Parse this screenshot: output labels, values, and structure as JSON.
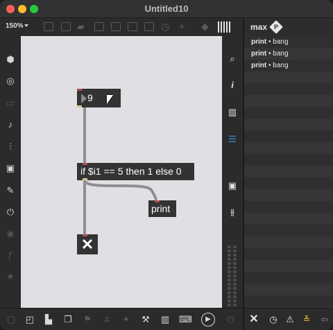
{
  "window": {
    "title": "Untitled10"
  },
  "toolbar": {
    "zoom": "150%"
  },
  "patch": {
    "number_box": {
      "value": "9"
    },
    "if_object": {
      "text": "if $i1 == 5 then 1 else 0"
    },
    "print_object": {
      "text": "print"
    },
    "toggle": {
      "glyph": "✕"
    }
  },
  "console": {
    "title": "max",
    "badge": "P",
    "messages": [
      {
        "object": "print",
        "separator": " • ",
        "message": "bang"
      },
      {
        "object": "print",
        "separator": " • ",
        "message": "bang"
      },
      {
        "object": "print",
        "separator": " • ",
        "message": "bang"
      }
    ]
  },
  "colors": {
    "canvas": "#e1dfe3",
    "object": "#333333",
    "cable": "#8e8e8e",
    "inlet": "#b05050",
    "outlet": "#d6c98a",
    "active_list_icon": "#3f8fd6",
    "warning_yellow": "#f2c12e"
  }
}
